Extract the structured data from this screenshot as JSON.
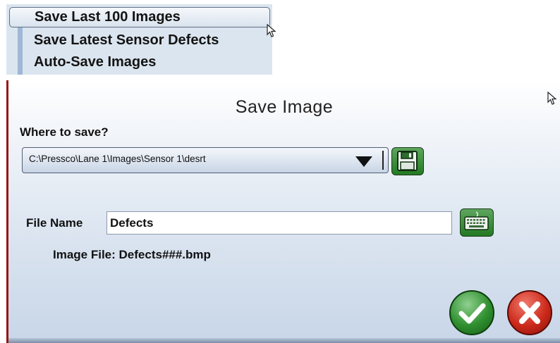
{
  "menu": {
    "items": [
      {
        "label": "Save Last 100 Images",
        "selected": true
      },
      {
        "label": "Save Latest Sensor Defects",
        "selected": false
      },
      {
        "label": "Auto-Save Images",
        "selected": false
      }
    ]
  },
  "dialog": {
    "title": "Save Image",
    "where_label": "Where to save?",
    "save_path": "C:\\Pressco\\Lane 1\\Images\\Sensor 1\\desrt",
    "file_name_label": "File Name",
    "file_name_value": "Defects",
    "image_file_label": "Image File: Defects###.bmp"
  },
  "icons": {
    "save": "floppy-disk-icon",
    "keyboard": "keyboard-icon",
    "ok": "checkmark-icon",
    "cancel": "x-icon",
    "cursor": "mouse-pointer-icon",
    "dropdown": "triangle-down-icon"
  },
  "colors": {
    "accent_green": "#237a23",
    "accent_red": "#cc2a1a",
    "dialog_border": "#9a1414",
    "menu_bg": "#dbe5ef"
  }
}
